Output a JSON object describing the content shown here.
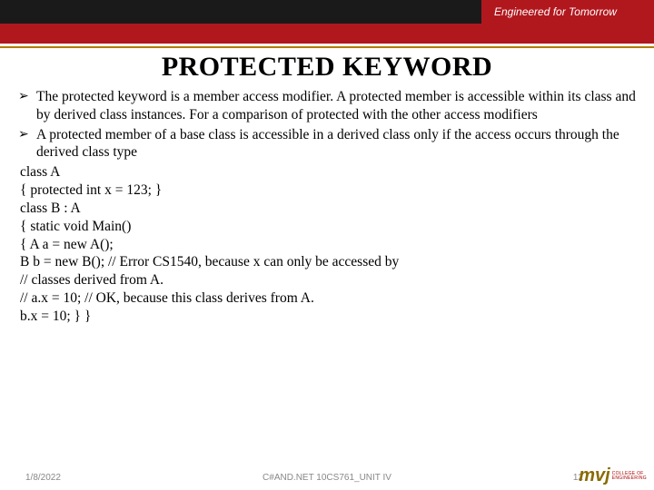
{
  "header": {
    "tagline": "Engineered for Tomorrow"
  },
  "title": "PROTECTED KEYWORD",
  "bullets": [
    "The protected keyword is a member access modifier. A protected member is accessible within its class and by derived class instances. For a comparison of protected with the other access modifiers",
    "A protected member of a base class is accessible in a derived class only if the access occurs through the derived class type"
  ],
  "code_lines": [
    "class A",
    "{ protected int x = 123; }",
    "class B : A",
    "{ static void Main()",
    "{ A a = new A();",
    "B b = new B(); // Error CS1540, because x can only be accessed by",
    " // classes derived from A.",
    "// a.x = 10;   // OK, because this class derives from A.",
    "b.x = 10; } }"
  ],
  "footer": {
    "date": "1/8/2022",
    "center": "C#AND.NET 10CS761_UNIT IV",
    "page": "12"
  },
  "logo": {
    "mark": "mvj",
    "line1": "COLLEGE OF",
    "line2": "ENGINEERING"
  }
}
